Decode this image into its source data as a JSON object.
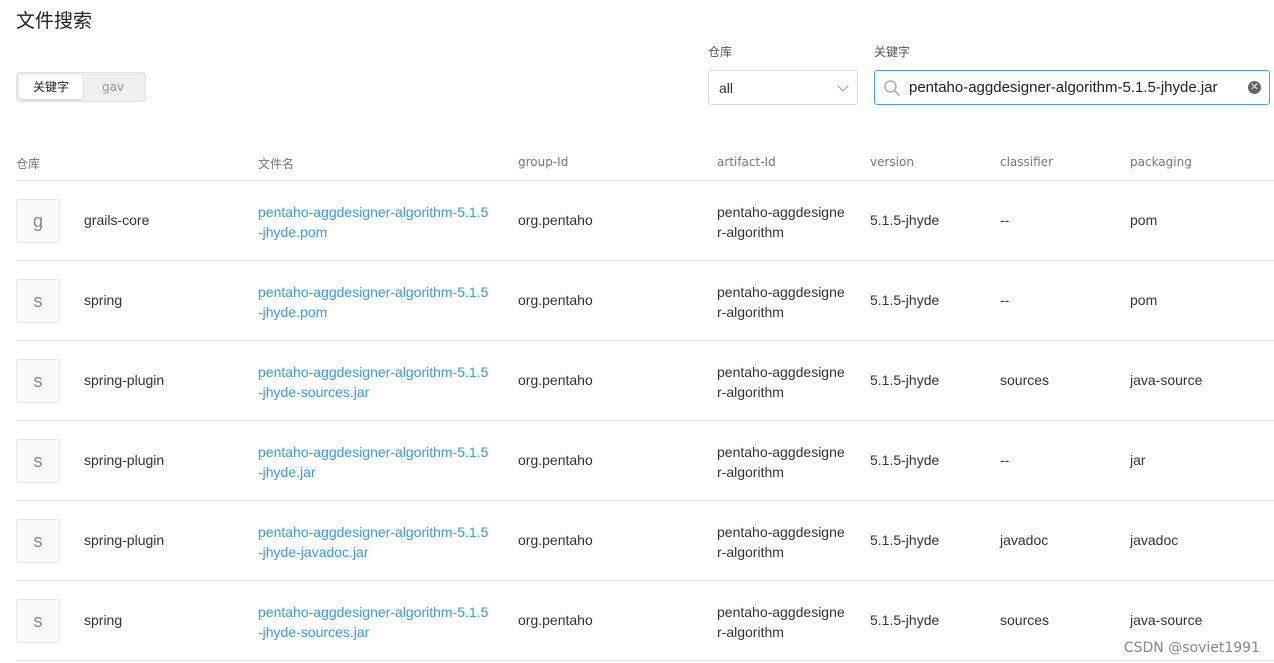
{
  "page": {
    "title": "文件搜索"
  },
  "search_mode": {
    "options": [
      "关键字",
      "gav"
    ],
    "selected": "关键字"
  },
  "repository_filter": {
    "label": "仓库",
    "value": "all"
  },
  "keyword_filter": {
    "label": "关键字",
    "value": "pentaho-aggdesigner-algorithm-5.1.5-jhyde.jar"
  },
  "table": {
    "columns": [
      "仓库",
      "文件名",
      "group-Id",
      "artifact-Id",
      "version",
      "classifier",
      "packaging"
    ],
    "rows": [
      {
        "avatar": "g",
        "repository": "grails-core",
        "filename_line1": "pentaho-aggdesigner-algorithm-5.1.5",
        "filename_line2": "-jhyde.pom",
        "group_id": "org.pentaho",
        "artifact_line1": "pentaho-aggdesigne",
        "artifact_line2": "r-algorithm",
        "version": "5.1.5-jhyde",
        "classifier": "--",
        "packaging": "pom"
      },
      {
        "avatar": "s",
        "repository": "spring",
        "filename_line1": "pentaho-aggdesigner-algorithm-5.1.5",
        "filename_line2": "-jhyde.pom",
        "group_id": "org.pentaho",
        "artifact_line1": "pentaho-aggdesigne",
        "artifact_line2": "r-algorithm",
        "version": "5.1.5-jhyde",
        "classifier": "--",
        "packaging": "pom"
      },
      {
        "avatar": "s",
        "repository": "spring-plugin",
        "filename_line1": "pentaho-aggdesigner-algorithm-5.1.5",
        "filename_line2": "-jhyde-sources.jar",
        "group_id": "org.pentaho",
        "artifact_line1": "pentaho-aggdesigne",
        "artifact_line2": "r-algorithm",
        "version": "5.1.5-jhyde",
        "classifier": "sources",
        "packaging": "java-source"
      },
      {
        "avatar": "s",
        "repository": "spring-plugin",
        "filename_line1": "pentaho-aggdesigner-algorithm-5.1.5",
        "filename_line2": "-jhyde.jar",
        "group_id": "org.pentaho",
        "artifact_line1": "pentaho-aggdesigne",
        "artifact_line2": "r-algorithm",
        "version": "5.1.5-jhyde",
        "classifier": "--",
        "packaging": "jar"
      },
      {
        "avatar": "s",
        "repository": "spring-plugin",
        "filename_line1": "pentaho-aggdesigner-algorithm-5.1.5",
        "filename_line2": "-jhyde-javadoc.jar",
        "group_id": "org.pentaho",
        "artifact_line1": "pentaho-aggdesigne",
        "artifact_line2": "r-algorithm",
        "version": "5.1.5-jhyde",
        "classifier": "javadoc",
        "packaging": "javadoc"
      },
      {
        "avatar": "s",
        "repository": "spring",
        "filename_line1": "pentaho-aggdesigner-algorithm-5.1.5",
        "filename_line2": "-jhyde-sources.jar",
        "group_id": "org.pentaho",
        "artifact_line1": "pentaho-aggdesigne",
        "artifact_line2": "r-algorithm",
        "version": "5.1.5-jhyde",
        "classifier": "sources",
        "packaging": "java-source"
      }
    ]
  },
  "watermark": "CSDN @soviet1991",
  "colors": {
    "link": "#3a9ad9",
    "focus_border": "#4aa3e8"
  }
}
